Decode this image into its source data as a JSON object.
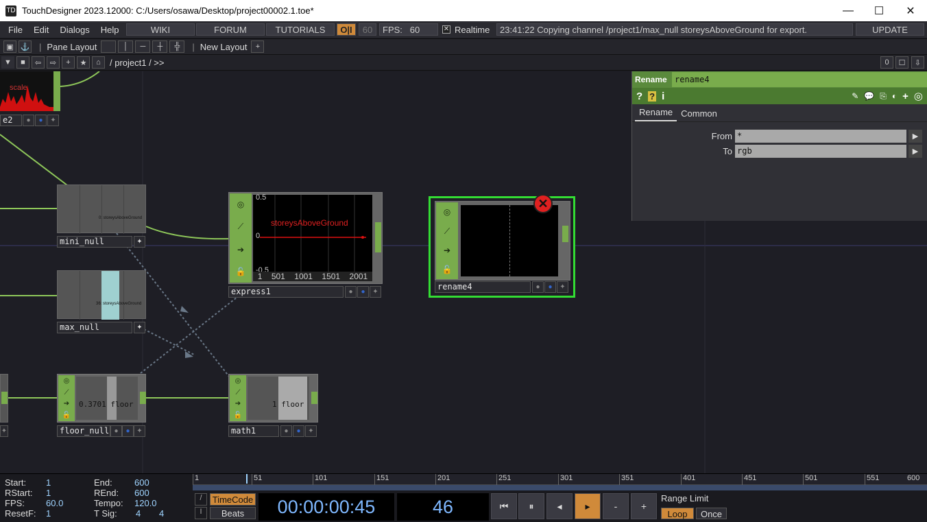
{
  "window": {
    "title": "TouchDesigner 2023.12000: C:/Users/osawa/Desktop/project00002.1.toe*",
    "minimize": "—",
    "maximize": "☐",
    "close": "✕"
  },
  "menu": {
    "items": [
      "File",
      "Edit",
      "Dialogs",
      "Help"
    ],
    "wiki": "WIKI",
    "forum": "FORUM",
    "tutorials": "TUTORIALS",
    "oi": "O|I",
    "fps_set": "60",
    "fps_label": "FPS:",
    "fps_value": "60",
    "realtime": "Realtime",
    "status": "23:41:22 Copying channel /project1/max_null storeysAboveGround for export.",
    "update": "UPDATE"
  },
  "layout": {
    "pane_layout": "Pane Layout",
    "new_layout": "New Layout"
  },
  "path": {
    "crumb": "/ project1 / >>",
    "num": "0"
  },
  "nodes": {
    "top_left": {
      "name": "e2",
      "text": "scale"
    },
    "mini_null": {
      "name": "mini_null",
      "text": "0: storeysAboveGround"
    },
    "max_null": {
      "name": "max_null",
      "text": "36: storeysAboveGround"
    },
    "express1": {
      "name": "express1",
      "channel": "storeysAboveGround",
      "ytop": "0.5",
      "ymid": "0",
      "ybot": "-0.5",
      "xticks": [
        "1",
        "501",
        "1001",
        "1501",
        "2001"
      ]
    },
    "rename4": {
      "name": "rename4",
      "error": "✕"
    },
    "floor_null": {
      "name": "floor_null",
      "text": "0.3701 floor"
    },
    "math1": {
      "name": "math1",
      "text": "1 floor"
    }
  },
  "params": {
    "op_type": "Rename",
    "op_name": "rename4",
    "tabs": [
      "Rename",
      "Common"
    ],
    "from_label": "From",
    "from_value": "*",
    "to_label": "To",
    "to_value": "rgb"
  },
  "timeline": {
    "start_label": "Start:",
    "start": "1",
    "end_label": "End:",
    "end": "600",
    "rstart_label": "RStart:",
    "rstart": "1",
    "rend_label": "REnd:",
    "rend": "600",
    "fps_label": "FPS:",
    "fps": "60.0",
    "tempo_label": "Tempo:",
    "tempo": "120.0",
    "resetf_label": "ResetF:",
    "resetf": "1",
    "tsig_label": "T Sig:",
    "tsig1": "4",
    "tsig2": "4",
    "ruler": [
      "1",
      "51",
      "101",
      "151",
      "201",
      "251",
      "301",
      "351",
      "401",
      "451",
      "501",
      "551",
      "600"
    ],
    "timecode": "TimeCode",
    "beats": "Beats",
    "clock": "00:00:00:45",
    "frame": "46",
    "range_limit": "Range Limit",
    "loop": "Loop",
    "once": "Once"
  },
  "colors": {
    "accent": "#79ac4c",
    "selected": "#33cc33",
    "error": "#e02020"
  }
}
